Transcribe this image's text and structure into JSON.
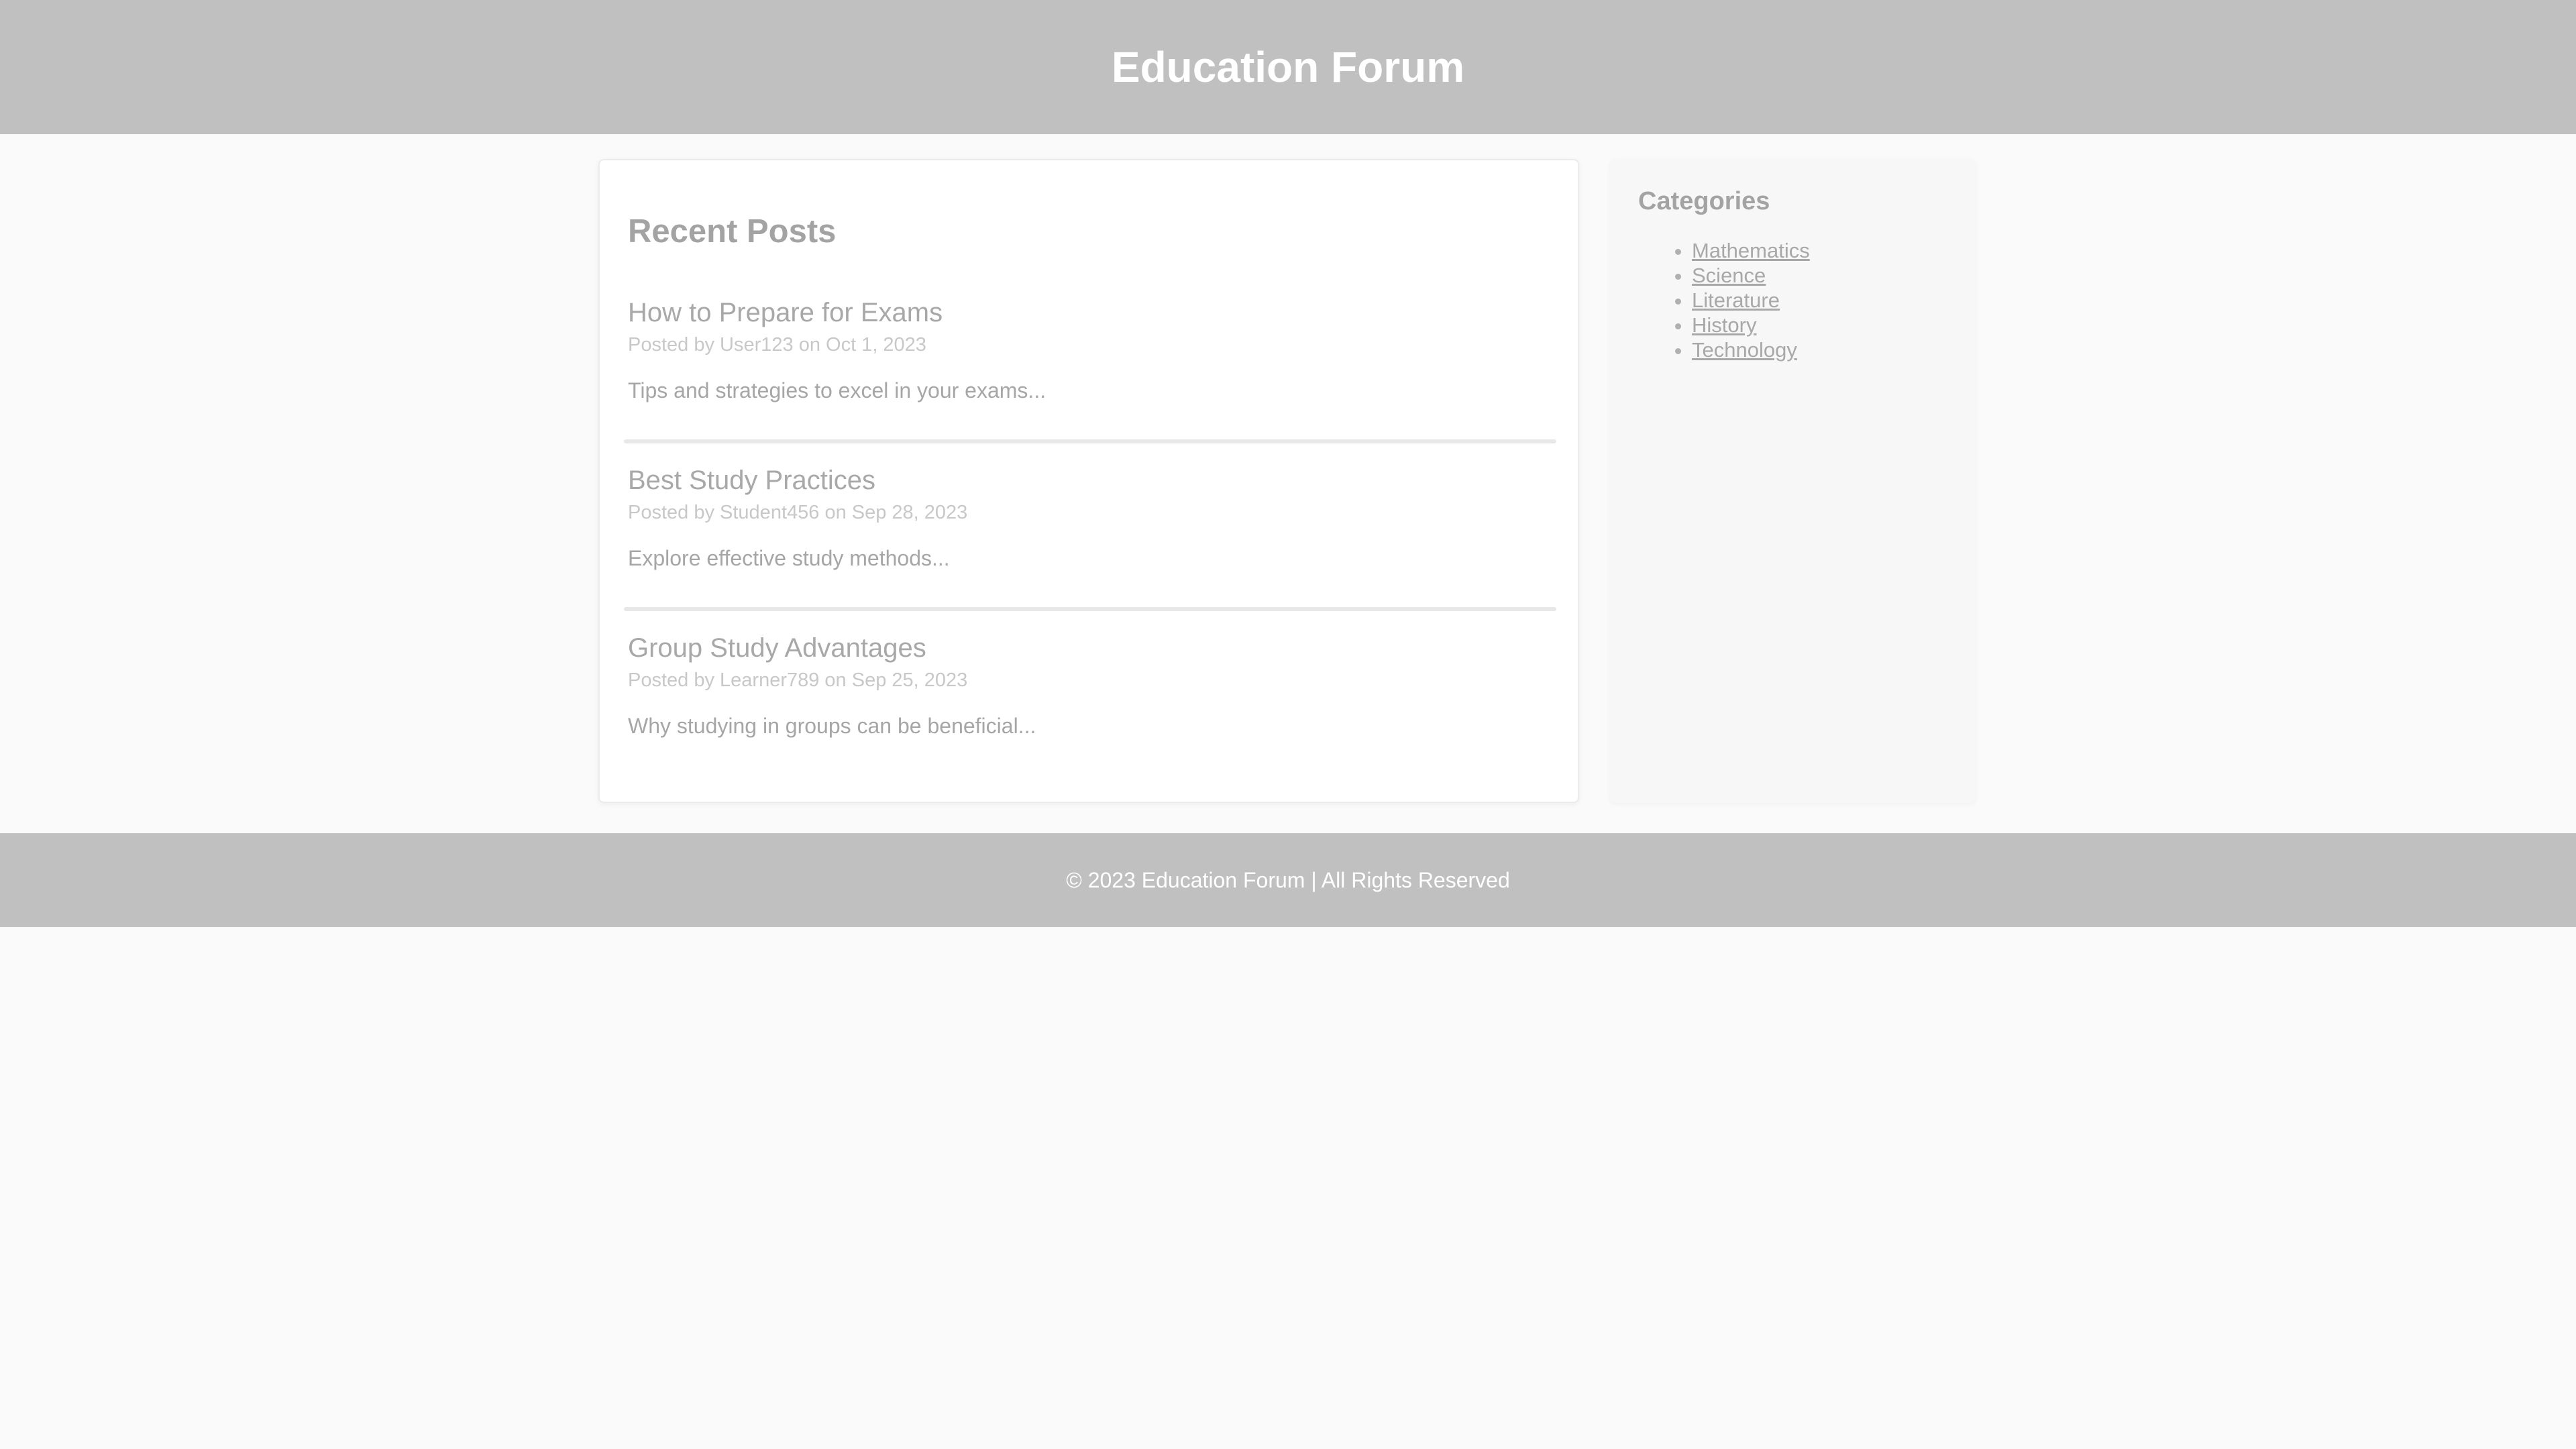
{
  "header": {
    "title": "Education Forum"
  },
  "main": {
    "section_title": "Recent Posts",
    "posts": [
      {
        "title": "How to Prepare for Exams",
        "meta": "Posted by User123 on Oct 1, 2023",
        "excerpt": "Tips and strategies to excel in your exams..."
      },
      {
        "title": "Best Study Practices",
        "meta": "Posted by Student456 on Sep 28, 2023",
        "excerpt": "Explore effective study methods..."
      },
      {
        "title": "Group Study Advantages",
        "meta": "Posted by Learner789 on Sep 25, 2023",
        "excerpt": "Why studying in groups can be beneficial..."
      }
    ]
  },
  "sidebar": {
    "title": "Categories",
    "categories": [
      "Mathematics",
      "Science",
      "Literature",
      "History",
      "Technology"
    ]
  },
  "footer": {
    "text": "© 2023 Education Forum | All Rights Reserved"
  },
  "colors": {
    "header_bg": "#c0c0c0",
    "page_bg": "#fafafa",
    "card_bg": "#ffffff"
  }
}
